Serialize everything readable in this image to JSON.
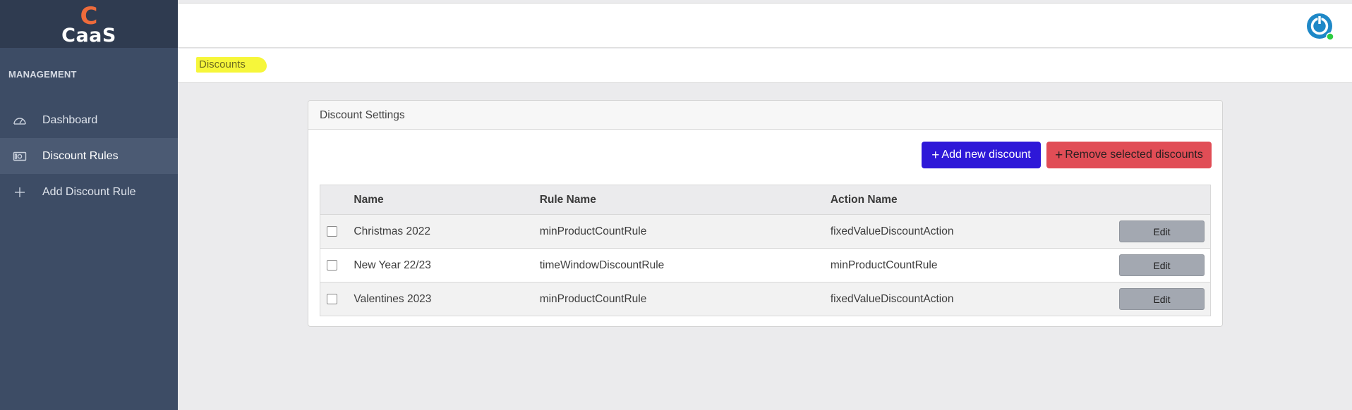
{
  "brand": {
    "mark": "C",
    "name": "CaaS"
  },
  "sidebar": {
    "section_title": "MANAGEMENT",
    "items": [
      {
        "label": "Dashboard",
        "icon": "gauge-icon",
        "active": false
      },
      {
        "label": "Discount Rules",
        "icon": "money-icon",
        "active": true
      },
      {
        "label": "Add Discount Rule",
        "icon": "plus-icon",
        "active": false
      }
    ]
  },
  "header": {
    "power_icon": "power-icon",
    "status_color": "#2ecc40"
  },
  "breadcrumb": {
    "label": "Discounts",
    "highlight_color": "#f6f63a"
  },
  "card": {
    "title": "Discount Settings",
    "add_button": "Add new discount",
    "remove_button": "Remove selected discounts",
    "columns": {
      "name": "Name",
      "rule": "Rule Name",
      "action": "Action Name"
    },
    "rows": [
      {
        "name": "Christmas 2022",
        "rule": "minProductCountRule",
        "action": "fixedValueDiscountAction",
        "edit": "Edit",
        "checked": false
      },
      {
        "name": "New Year 22/23",
        "rule": "timeWindowDiscountRule",
        "action": "minProductCountRule",
        "edit": "Edit",
        "checked": false
      },
      {
        "name": "Valentines 2023",
        "rule": "minProductCountRule",
        "action": "fixedValueDiscountAction",
        "edit": "Edit",
        "checked": false
      }
    ]
  },
  "colors": {
    "sidebar": "#3d4c65",
    "add_button": "#2e18d8",
    "remove_button": "#e14d56",
    "edit_button": "#a3a8b1"
  }
}
